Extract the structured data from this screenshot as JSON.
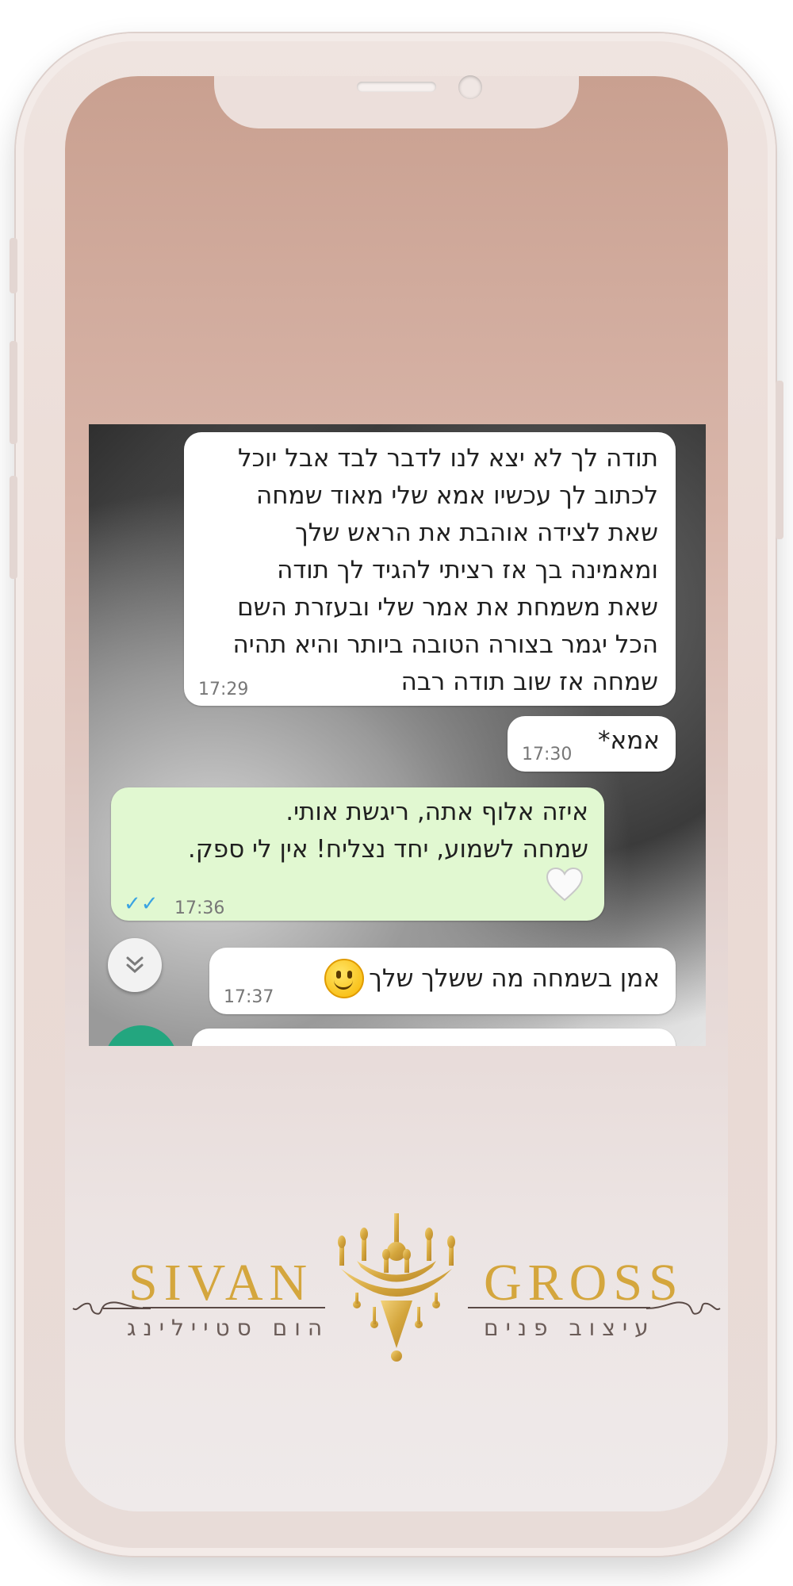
{
  "chat": {
    "messages": [
      {
        "direction": "incoming",
        "text": "תודה לך לא יצא לנו לדבר לבד אבל יוכל\nלכתוב לך עכשיו אמא שלי מאוד שמחה\nשאת לצידה אוהבת את הראש שלך\nומאמינה בך אז רציתי להגיד לך תודה\nשאת משמחת את אמר שלי ובעזרת השם\nהכל יגמר בצורה הטובה ביותר והיא תהיה\nשמחה אז שוב תודה רבה",
        "time": "17:29"
      },
      {
        "direction": "incoming",
        "text": "אמא*",
        "time": "17:30"
      },
      {
        "direction": "outgoing",
        "text": "איזה אלוף אתה, ריגשת אותי.\nשמחה לשמוע, יחד נצליח! אין לי ספק.",
        "time": "17:36",
        "status": "read"
      },
      {
        "direction": "incoming",
        "text": "אמן בשמחה מה ששלך שלך",
        "time": "17:37"
      }
    ]
  },
  "logo": {
    "left_word": "SIVAN",
    "right_word": "GROSS",
    "left_sub": "הום סטיילינג",
    "right_sub": "עיצוב פנים",
    "color": "#d4a63d"
  },
  "colors": {
    "incoming_bubble": "#ffffff",
    "outgoing_bubble": "#e1f8d1",
    "read_ticks": "#3aa3e2",
    "fab": "#23a67f"
  },
  "icons": {
    "scroll_down": "double-chevron-down-icon",
    "read_receipt": "double-check-icon",
    "heart": "white-heart-icon",
    "emoji": "smiling-face-icon"
  }
}
